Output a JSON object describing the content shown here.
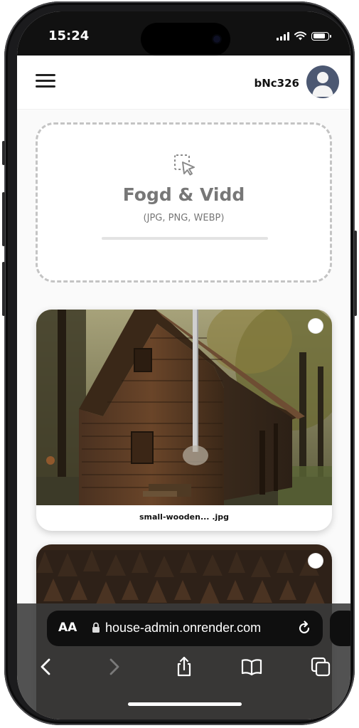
{
  "status_bar": {
    "time": "15:24",
    "icons": [
      "cellular-signal-icon",
      "wifi-icon",
      "battery-icon"
    ],
    "battery_level": 0.8
  },
  "header": {
    "menu_icon": "hamburger-menu-icon",
    "username": "bNc326",
    "avatar_icon": "user-avatar-icon"
  },
  "upload": {
    "icon": "upload-pointer-icon",
    "title": "Fogd & Vidd",
    "formats": "(JPG, PNG, WEBP)",
    "progress": 0
  },
  "images": [
    {
      "caption": "small-wooden... .jpg",
      "selected": false
    },
    {
      "caption": "",
      "selected": false
    }
  ],
  "safari": {
    "text_size_label": "AA",
    "url": "house-admin.onrender.com",
    "toolbar": [
      "back-icon",
      "forward-icon",
      "share-icon",
      "bookmarks-icon",
      "tabs-icon"
    ]
  },
  "colors": {
    "header_bg": "#ffffff",
    "dashed_border": "#c4c4c4",
    "upload_text": "#777777",
    "avatar_bg": "#4c5872"
  }
}
